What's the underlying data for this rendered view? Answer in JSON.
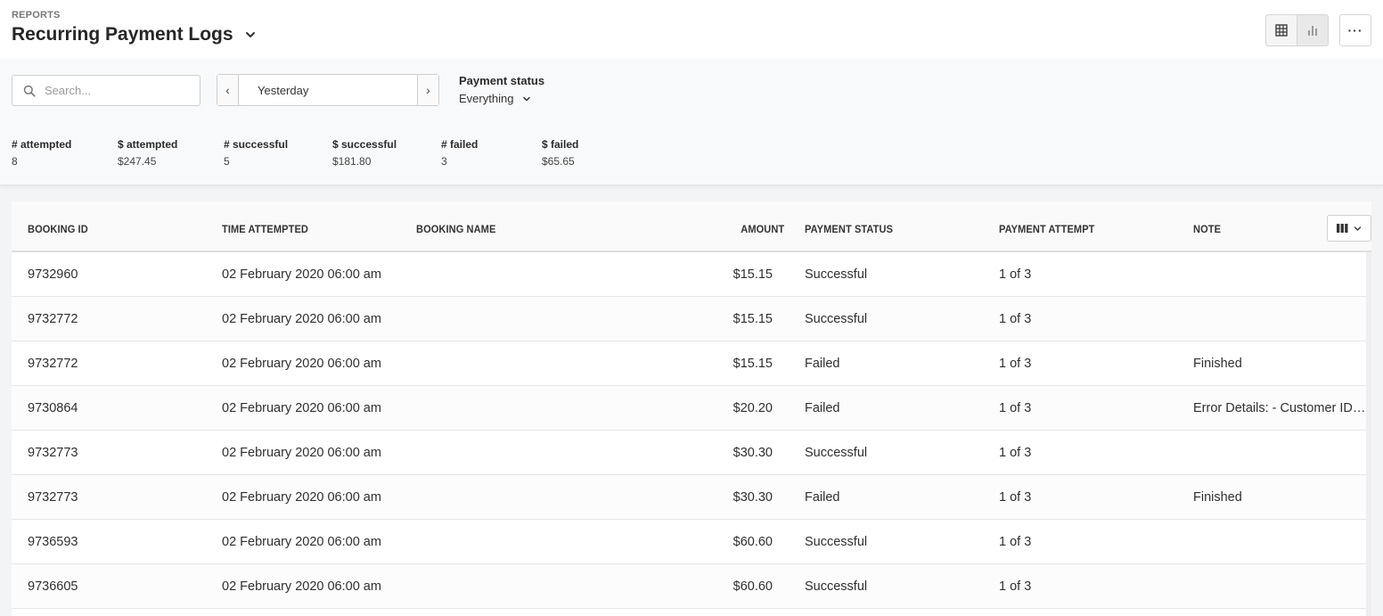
{
  "header": {
    "section_label": "REPORTS",
    "title": "Recurring Payment Logs",
    "title_icon": "chevron-down-icon",
    "view_toggle": [
      {
        "icon": "grid-icon",
        "active": true
      },
      {
        "icon": "bar-chart-icon",
        "active": false
      }
    ],
    "more_label": "···"
  },
  "filters": {
    "search": {
      "placeholder": "Search...",
      "value": ""
    },
    "date": {
      "prev_label": "‹",
      "value": "Yesterday",
      "next_label": "›"
    },
    "payment_status": {
      "label": "Payment status",
      "value": "Everything"
    }
  },
  "summary": [
    {
      "label": "# attempted",
      "value": "8"
    },
    {
      "label": "$ attempted",
      "value": "$247.45"
    },
    {
      "label": "# successful",
      "value": "5"
    },
    {
      "label": "$ successful",
      "value": "$181.80"
    },
    {
      "label": "# failed",
      "value": "3"
    },
    {
      "label": "$ failed",
      "value": "$65.65"
    }
  ],
  "table": {
    "columns": [
      "BOOKING ID",
      "TIME ATTEMPTED",
      "BOOKING NAME",
      "AMOUNT",
      "PAYMENT STATUS",
      "PAYMENT ATTEMPT",
      "NOTE"
    ],
    "rows": [
      {
        "booking_id": "9732960",
        "time": "02 February 2020 06:00 am",
        "name": "",
        "amount": "$15.15",
        "status": "Successful",
        "attempt": "1 of 3",
        "note": ""
      },
      {
        "booking_id": "9732772",
        "time": "02 February 2020 06:00 am",
        "name": "",
        "amount": "$15.15",
        "status": "Successful",
        "attempt": "1 of 3",
        "note": ""
      },
      {
        "booking_id": "9732772",
        "time": "02 February 2020 06:00 am",
        "name": "",
        "amount": "$15.15",
        "status": "Failed",
        "attempt": "1 of 3",
        "note": "Finished"
      },
      {
        "booking_id": "9730864",
        "time": "02 February 2020 06:00 am",
        "name": "",
        "amount": "$20.20",
        "status": "Failed",
        "attempt": "1 of 3",
        "note": "Error Details: - Customer ID…"
      },
      {
        "booking_id": "9732773",
        "time": "02 February 2020 06:00 am",
        "name": "",
        "amount": "$30.30",
        "status": "Successful",
        "attempt": "1 of 3",
        "note": ""
      },
      {
        "booking_id": "9732773",
        "time": "02 February 2020 06:00 am",
        "name": "",
        "amount": "$30.30",
        "status": "Failed",
        "attempt": "1 of 3",
        "note": "Finished"
      },
      {
        "booking_id": "9736593",
        "time": "02 February 2020 06:00 am",
        "name": "",
        "amount": "$60.60",
        "status": "Successful",
        "attempt": "1 of 3",
        "note": ""
      },
      {
        "booking_id": "9736605",
        "time": "02 February 2020 06:00 am",
        "name": "",
        "amount": "$60.60",
        "status": "Successful",
        "attempt": "1 of 3",
        "note": ""
      }
    ]
  }
}
